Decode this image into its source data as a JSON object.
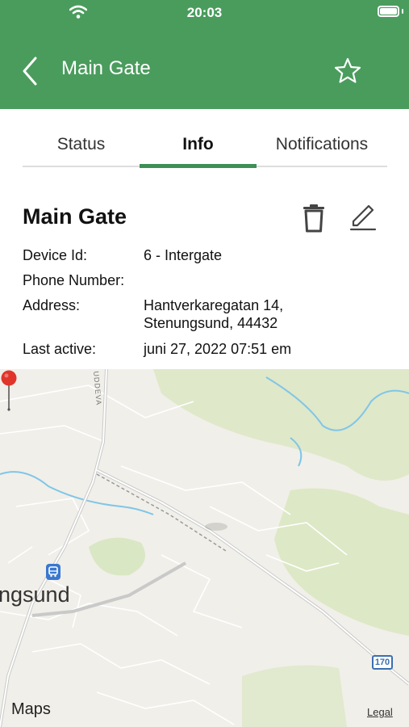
{
  "status_bar": {
    "time": "20:03"
  },
  "header": {
    "title": "Main Gate"
  },
  "tabs": [
    {
      "label": "Status",
      "active": false
    },
    {
      "label": "Info",
      "active": true
    },
    {
      "label": "Notifications",
      "active": false
    }
  ],
  "device": {
    "name": "Main Gate",
    "fields": {
      "device_id": {
        "label": "Device Id:",
        "value": "6 - Intergate"
      },
      "phone": {
        "label": "Phone Number:",
        "value": ""
      },
      "address": {
        "label": "Address:",
        "value_line1": "Hantverkaregatan 14,",
        "value_line2": "Stenungsund, 44432"
      },
      "last_active": {
        "label": "Last active:",
        "value": "juni 27, 2022 07:51 em"
      }
    }
  },
  "map": {
    "city_label": "ngsund",
    "road_label": "UDDEVA",
    "road_shield": "170",
    "logo": "Maps",
    "legal": "Legal"
  },
  "colors": {
    "header_bg": "#4a9c5d",
    "tab_indicator": "#3d8f56",
    "pin": "#e0352b"
  },
  "icons": {
    "back": "chevron-left-icon",
    "favorite": "star-outline-icon",
    "delete": "trash-icon",
    "edit": "pencil-icon"
  }
}
